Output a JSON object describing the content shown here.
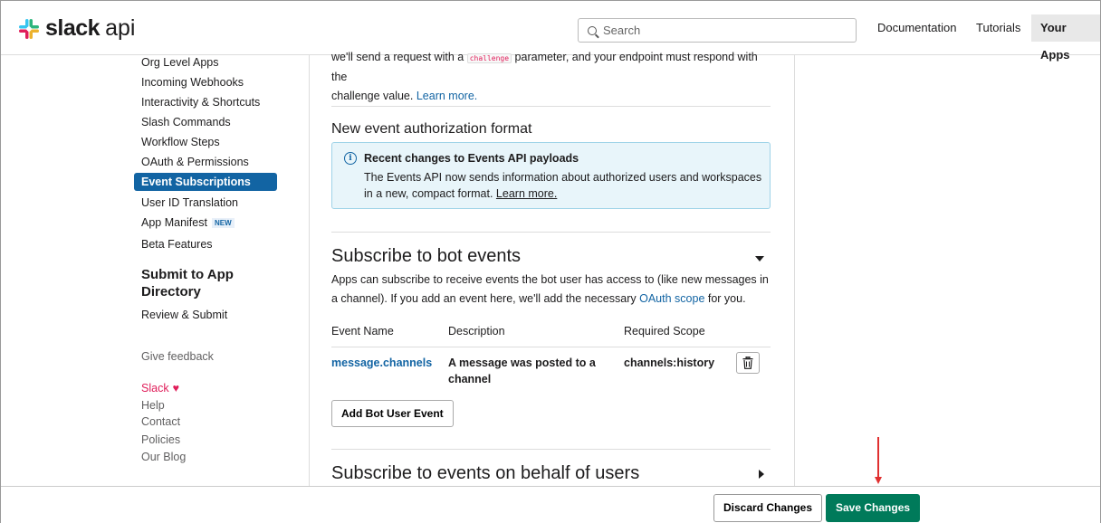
{
  "header": {
    "logo_text": "slack",
    "logo_sub": "api",
    "search_placeholder": "Search",
    "nav": {
      "documentation": "Documentation",
      "tutorials": "Tutorials",
      "your_apps": "Your Apps"
    }
  },
  "sidebar": {
    "items": [
      "Org Level Apps",
      "Incoming Webhooks",
      "Interactivity & Shortcuts",
      "Slash Commands",
      "Workflow Steps",
      "OAuth & Permissions"
    ],
    "active_item": "Event Subscriptions",
    "items_after": [
      "User ID Translation",
      "App Manifest",
      "Beta Features"
    ],
    "new_badge": "NEW",
    "submit_heading": "Submit to App Directory",
    "review_submit": "Review & Submit",
    "feedback": "Give feedback",
    "footer_links": {
      "slack": "Slack",
      "help": "Help",
      "contact": "Contact",
      "policies": "Policies",
      "blog": "Our Blog"
    }
  },
  "main": {
    "intro_before": "we'll send a request with a",
    "challenge_code": "challenge",
    "intro_after": "parameter, and your endpoint must respond with the",
    "intro_line2": "challenge value.",
    "learn_more": "Learn more.",
    "auth_heading": "New event authorization format",
    "info_title": "Recent changes to Events API payloads",
    "info_body": "The Events API now sends information about authorized users and workspaces in a new, compact format.",
    "info_link": "Learn more.",
    "bot_heading": "Subscribe to bot events",
    "bot_desc_1": "Apps can subscribe to receive events the bot user has access to (like new messages in a channel). If you add an event here, we'll add the necessary",
    "bot_desc_link": "OAuth scope",
    "bot_desc_2": "for you.",
    "table": {
      "headers": [
        "Event Name",
        "Description",
        "Required Scope"
      ],
      "rows": [
        {
          "event": "message.channels",
          "description": "A message was posted to a channel",
          "scope": "channels:history"
        }
      ]
    },
    "add_button": "Add Bot User Event",
    "user_heading": "Subscribe to events on behalf of users"
  },
  "footer": {
    "discard": "Discard Changes",
    "save": "Save Changes"
  },
  "colors": {
    "accent": "#1264a3",
    "save": "#007a5a",
    "annotation_arrow": "#e03030"
  }
}
